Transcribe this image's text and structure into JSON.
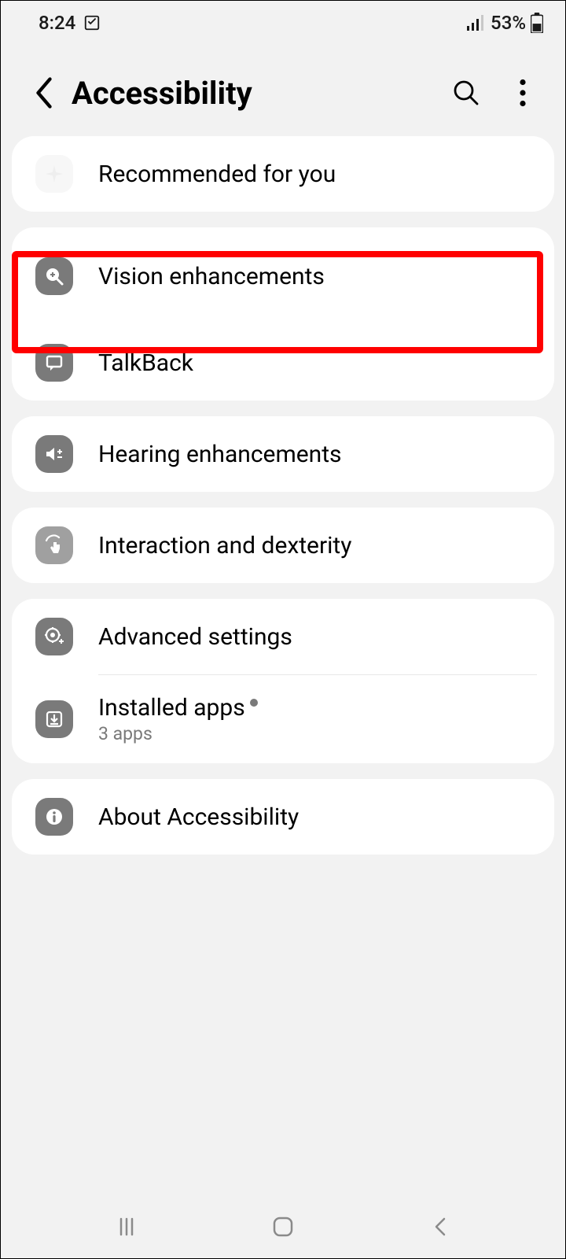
{
  "status": {
    "time": "8:24",
    "battery": "53%"
  },
  "header": {
    "title": "Accessibility"
  },
  "groups": [
    {
      "items": [
        {
          "id": "recommended",
          "label": "Recommended for you",
          "icon": "sparkle-icon",
          "iconStyle": "light"
        }
      ]
    },
    {
      "items": [
        {
          "id": "vision",
          "label": "Vision enhancements",
          "icon": "magnify-plus-icon"
        },
        {
          "id": "talkback",
          "label": "TalkBack",
          "icon": "speech-bubble-icon"
        }
      ]
    },
    {
      "items": [
        {
          "id": "hearing",
          "label": "Hearing enhancements",
          "icon": "volume-adjust-icon"
        }
      ]
    },
    {
      "items": [
        {
          "id": "interaction",
          "label": "Interaction and dexterity",
          "icon": "touch-icon",
          "iconStyle": "faded"
        }
      ]
    },
    {
      "items": [
        {
          "id": "advanced",
          "label": "Advanced settings",
          "icon": "gear-plus-icon"
        },
        {
          "id": "installed",
          "label": "Installed apps",
          "sub": "3 apps",
          "icon": "download-icon",
          "dot": true
        }
      ]
    },
    {
      "items": [
        {
          "id": "about",
          "label": "About Accessibility",
          "icon": "info-icon"
        }
      ]
    }
  ]
}
